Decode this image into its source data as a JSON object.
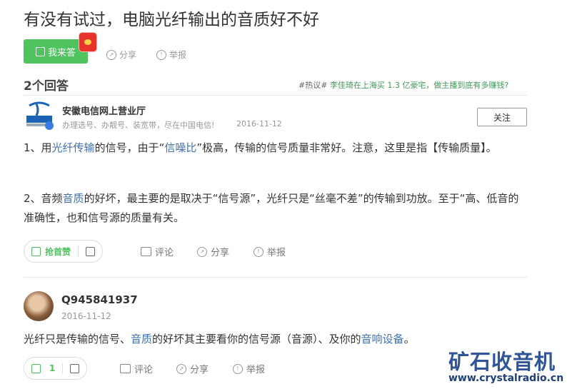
{
  "question": {
    "title": "有没有试过，电脑光纤输出的音质好不好",
    "answer_button": "我来答",
    "share": "分享",
    "report": "举报"
  },
  "answers_header": {
    "count": "2个回答",
    "hot_tag": "#热议#",
    "hot_text": "李佳琦在上海买 1.3 亿豪宅，做主播到底有多赚钱?"
  },
  "answer1": {
    "user": "安徽电信网上营业厅",
    "desc": "办理选号、办靓号、装宽带，尽在中国电信!",
    "date": "2016-11-12",
    "follow": "关注",
    "p1_a": "1、用",
    "p1_link1": "光纤传输",
    "p1_b": "的信号，由于“",
    "p1_link2": "信噪比",
    "p1_c": "”极高，传输的信号质量非常好。注意，这里是指【传输质量】。",
    "p2_a": "2、音频",
    "p2_link1": "音质",
    "p2_b": "的好坏，最主要的是取决于“信号源”，光纤只是“丝毫不差”的传输到功放。至于“高、低音的准确性，也和信号源的质量有关。",
    "like_label": "抢首赞",
    "comment": "评论",
    "share": "分享",
    "report": "举报"
  },
  "answer2": {
    "user": "Q945841937",
    "date": "2016-11-12",
    "t_a": "光纤只是传输的信号、",
    "t_link1": "音质",
    "t_b": "的好坏其主要看你的信号源（音源）、及你的",
    "t_link2": "音响设备",
    "t_c": "。",
    "like_count": "1",
    "comment": "评论",
    "share": "分享",
    "report": "举报"
  },
  "watermark": {
    "cn": "矿石收音机",
    "url": "www.crystalradio.cn"
  },
  "colors": {
    "brand_green": "#4ec35e",
    "link_blue": "#3e71b3",
    "hot_green": "#3e9a5a",
    "watermark_blue": "#2f5597"
  }
}
